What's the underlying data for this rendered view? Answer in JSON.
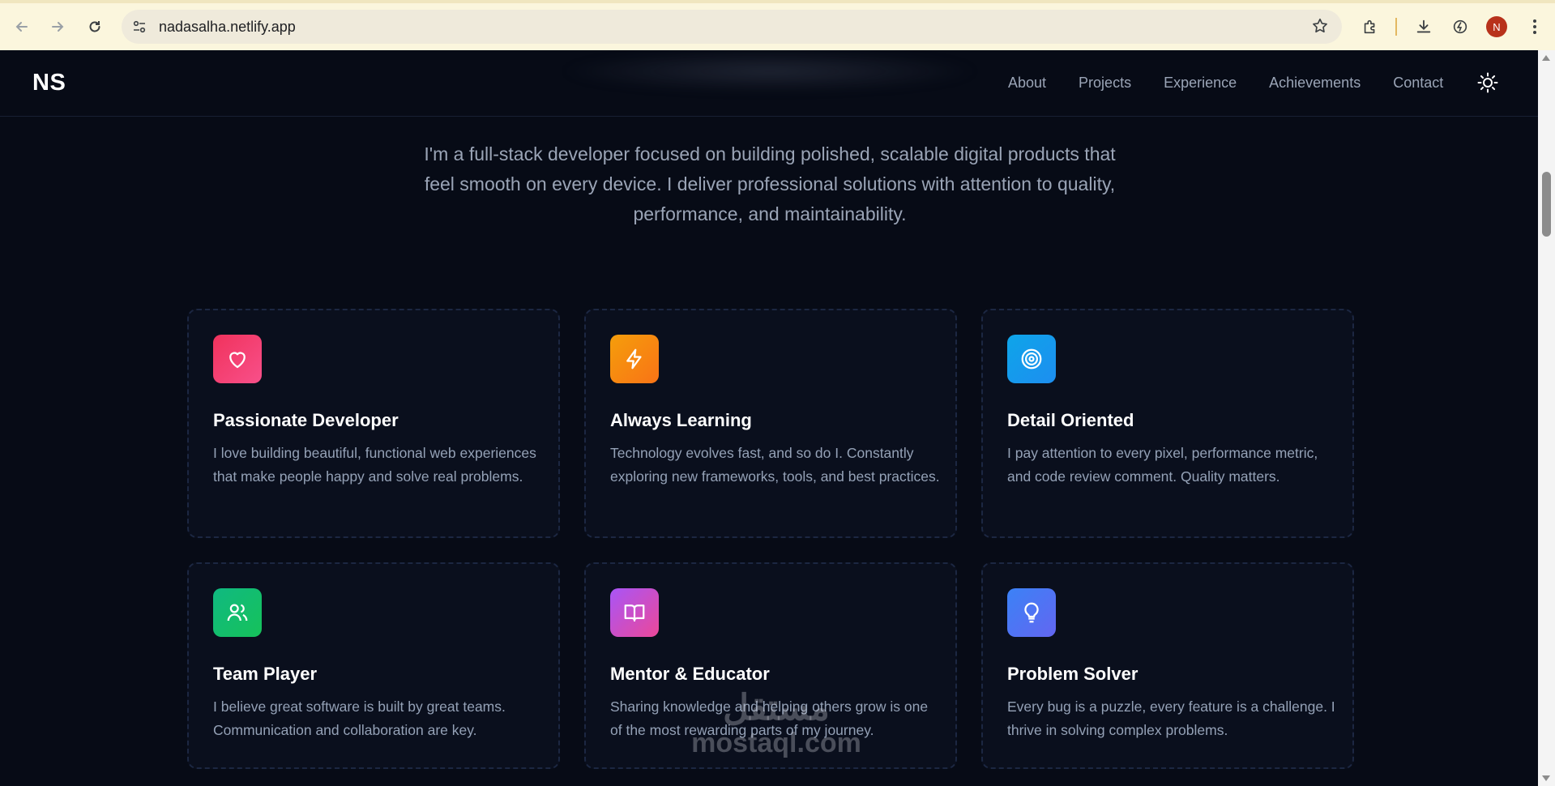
{
  "browser": {
    "url": "nadasalha.netlify.app",
    "profile_initial": "N",
    "icons": [
      "back-arrow-icon",
      "forward-arrow-icon",
      "reload-icon",
      "site-info-icon",
      "bookmark-star-icon",
      "extensions-icon",
      "download-icon",
      "performance-icon",
      "menu-dots-icon"
    ]
  },
  "site": {
    "logo": "NS",
    "nav": [
      {
        "label": "About"
      },
      {
        "label": "Projects"
      },
      {
        "label": "Experience"
      },
      {
        "label": "Achievements"
      },
      {
        "label": "Contact"
      }
    ],
    "theme_toggle_icon": "sun-icon"
  },
  "intro": {
    "line1": "I'm a full-stack developer focused on building polished, scalable digital products that",
    "line2": "feel smooth on every device. I deliver professional solutions with attention to quality,",
    "line3": "performance, and maintainability."
  },
  "cards": [
    {
      "icon": "heart-icon",
      "title": "Passionate Developer",
      "description": "I love building beautiful, functional web experiences that make people happy and solve real problems.",
      "color": "#f2386c"
    },
    {
      "icon": "lightning-icon",
      "title": "Always Learning",
      "description": "Technology evolves fast, and so do I. Constantly exploring new frameworks, tools, and best practices.",
      "color": "#f98a0c"
    },
    {
      "icon": "target-icon",
      "title": "Detail Oriented",
      "description": "I pay attention to every pixel, performance metric, and code review comment. Quality matters.",
      "color": "#0f96ef"
    },
    {
      "icon": "users-icon",
      "title": "Team Player",
      "description": "I believe great software is built by great teams. Communication and collaboration are key.",
      "color": "#12c162"
    },
    {
      "icon": "book-icon",
      "title": "Mentor & Educator",
      "description": "Sharing knowledge and helping others grow is one of the most rewarding parts of my journey.",
      "color": "#c845e0"
    },
    {
      "icon": "lightbulb-icon",
      "title": "Problem Solver",
      "description": "Every bug is a puzzle, every feature is a challenge. I thrive in solving complex problems.",
      "color": "#5b67f5"
    }
  ],
  "watermark": {
    "arabic": "مستقل",
    "latin": "mostaql.com"
  }
}
